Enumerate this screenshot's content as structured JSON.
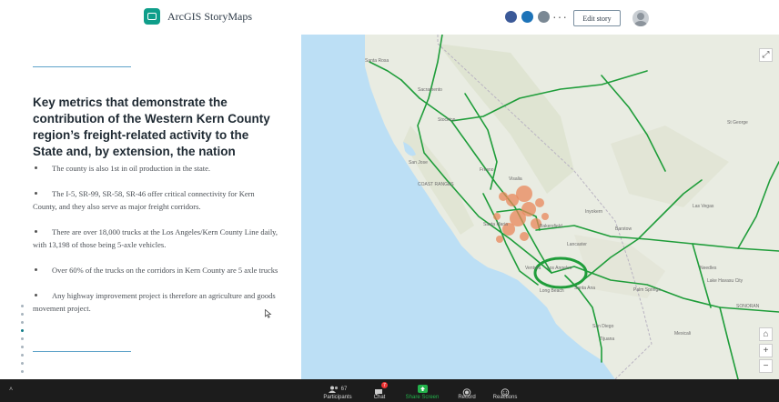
{
  "header": {
    "app_name": "ArcGIS StoryMaps",
    "more_label": "···",
    "edit_button": "Edit story",
    "share_colors": [
      "#3b5998",
      "#1d73b8",
      "#7a8894"
    ]
  },
  "story": {
    "heading": "Key metrics that demonstrate the contribution of the Western Kern County region’s freight-related activity to the State and, by extension, the nation",
    "bullets": [
      "The county is also 1st in oil production in the state.",
      "The I-5, SR-99, SR-58, SR-46 offer critical connectivity for Kern County, and they also serve as major freight corridors.",
      "There are over 18,000 trucks at the Los Angeles/Kern County Line daily, with 13,198 of those being 5-axle vehicles.",
      "Over 60% of the trucks on the corridors in Kern County are 5 axle trucks",
      "Any highway improvement project is therefore an agriculture and goods movement project."
    ],
    "nav_dot_count": 9,
    "nav_active_index": 3
  },
  "map": {
    "route_color": "#1f9d3a",
    "cluster_color": "#e8875a",
    "water_color": "#bcdff5",
    "land_color": "#e9ece2",
    "place_labels": [
      "Santa Rosa",
      "Sacramento",
      "Stockton",
      "San Jose",
      "Fresno",
      "Visalia",
      "Bakersfield",
      "Santa Maria",
      "Ventura",
      "Los Angeles",
      "Long Beach",
      "Santa Ana",
      "San Diego",
      "Tijuana",
      "Las Vegas",
      "Barstow",
      "Lancaster",
      "Palm Springs",
      "Mexicali",
      "St George",
      "COAST RANGES",
      "Inyokern",
      "Needles",
      "Lake Havasu City",
      "SONORAN"
    ],
    "controls": [
      "expand-icon",
      "home-icon",
      "zoom-in-icon",
      "zoom-out-icon"
    ],
    "zoom_in": "+",
    "zoom_out": "−"
  },
  "zoom_toolbar": {
    "participants_label": "Participants",
    "participants_count": "67",
    "chat_label": "Chat",
    "chat_badge": "7",
    "share_label": "Share Screen",
    "record_label": "Record",
    "reactions_label": "Reactions",
    "share_color": "#23b24b"
  }
}
